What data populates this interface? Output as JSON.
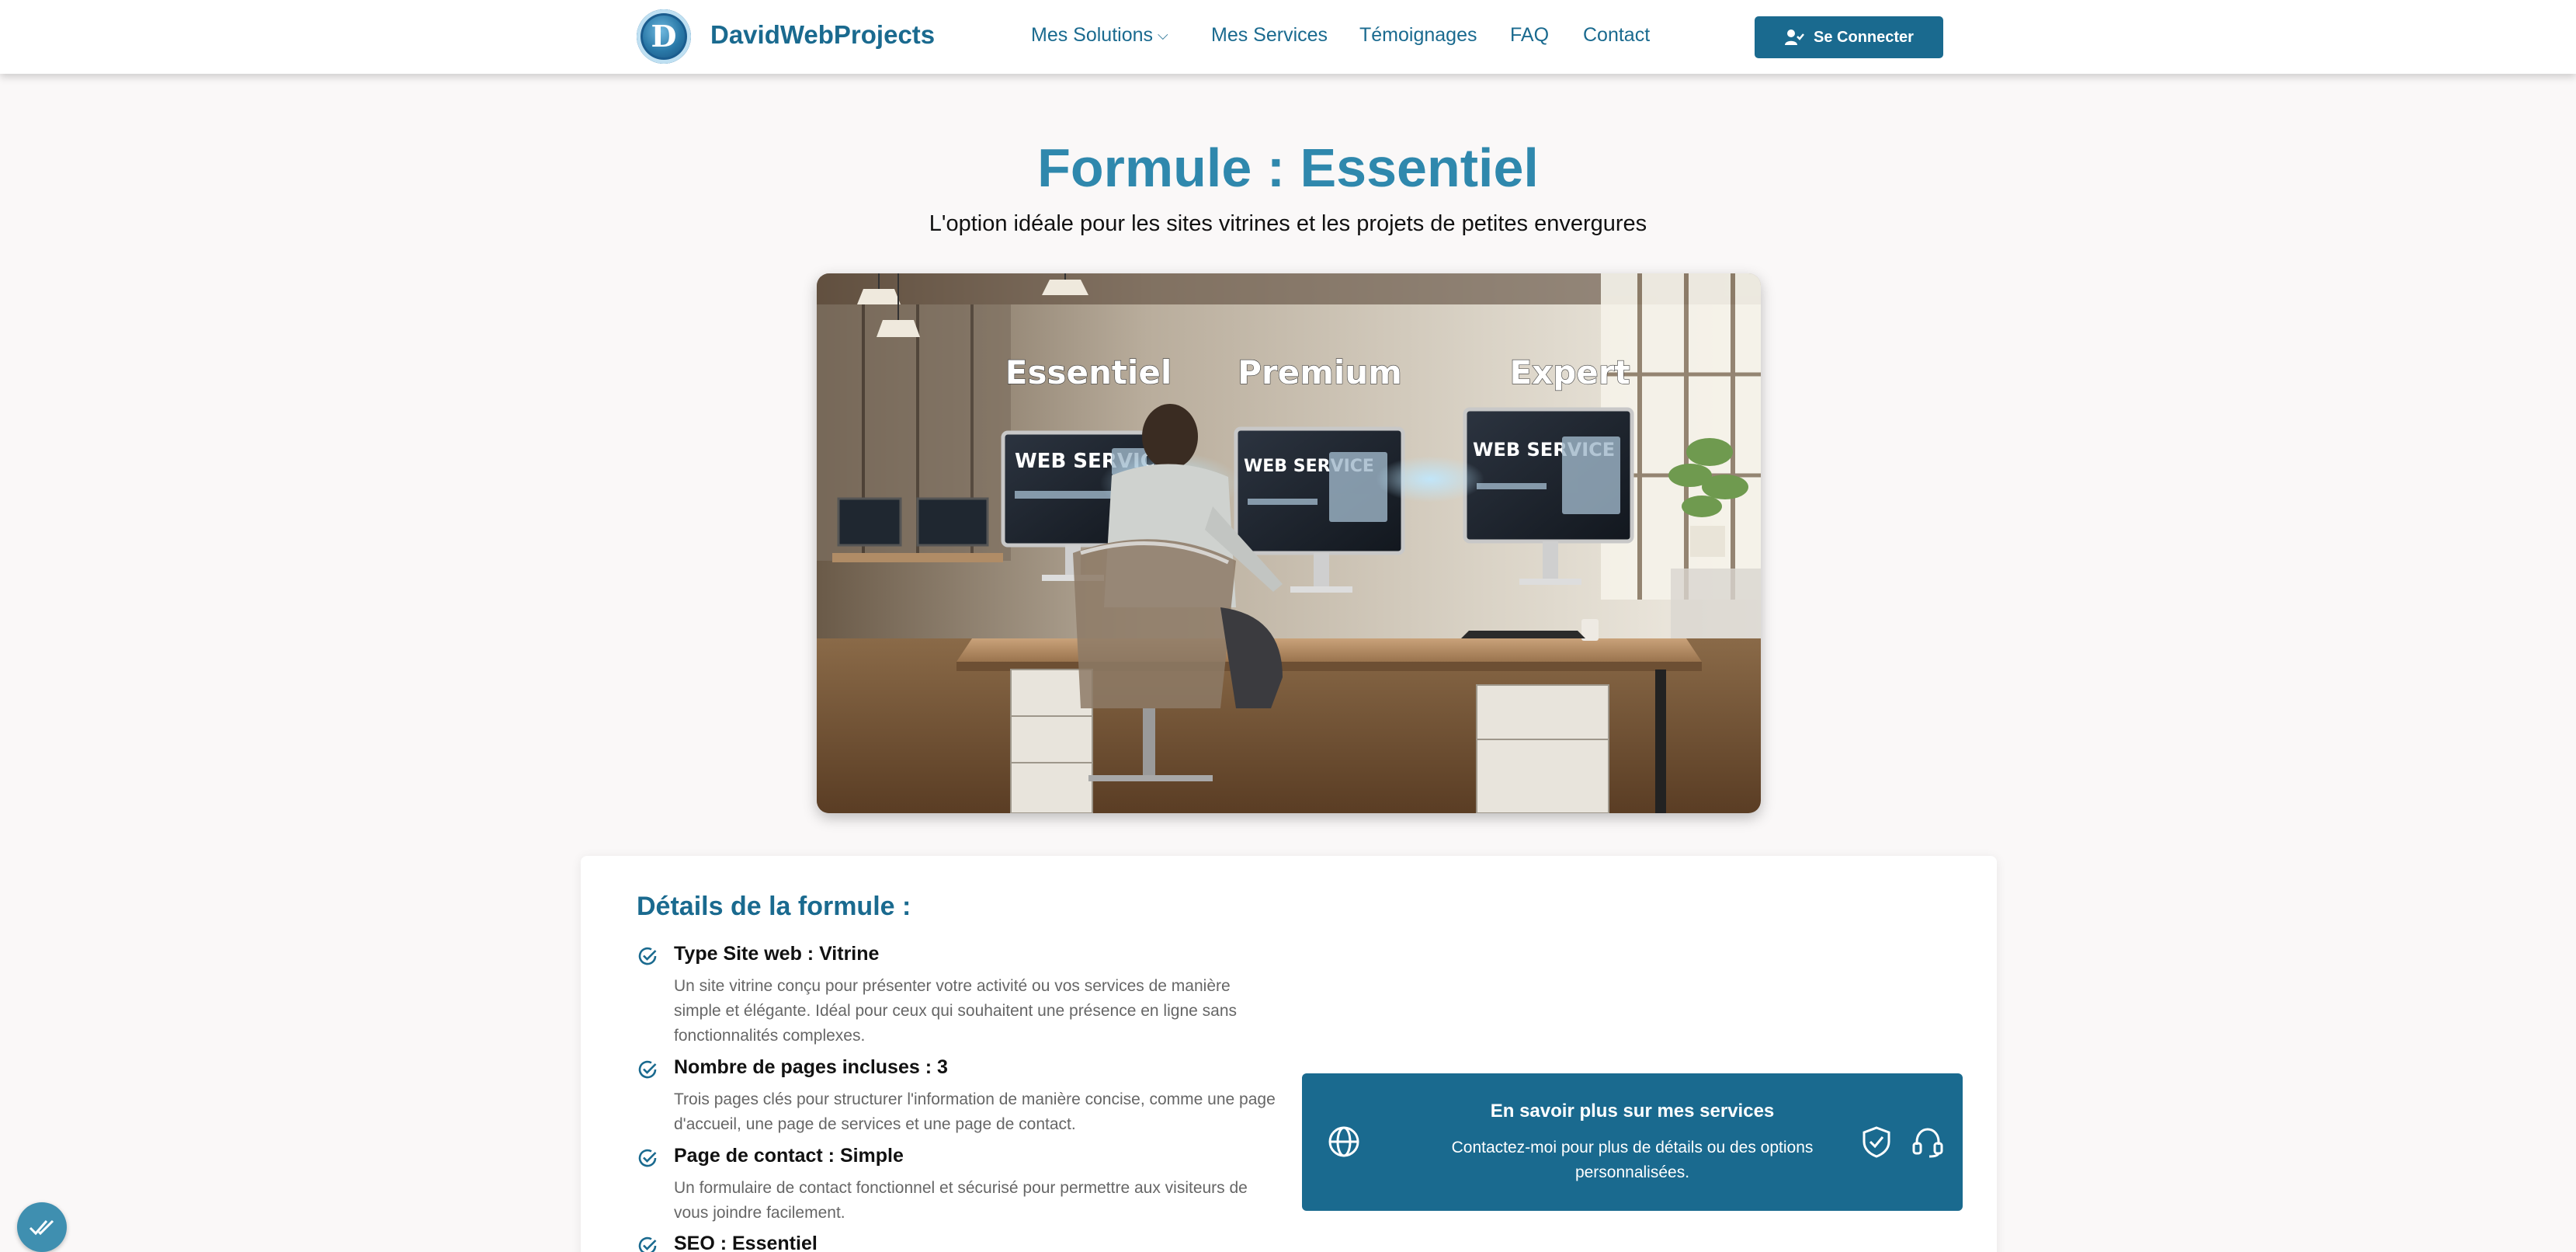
{
  "header": {
    "brand": "DavidWebProjects",
    "nav": [
      {
        "label": "Mes Solutions"
      },
      {
        "label": "Mes Services"
      },
      {
        "label": "Témoignages"
      },
      {
        "label": "FAQ"
      },
      {
        "label": "Contact"
      }
    ],
    "login_label": "Se Connecter"
  },
  "hero": {
    "title": "Formule : Essentiel",
    "subtitle": "L'option idéale pour les sites vitrines et les projets de petites envergures",
    "image_labels": [
      "Essentiel",
      "Premium",
      "Expert"
    ],
    "screen_text": [
      "WEB SERVICE",
      "WEB SERVICE",
      "WEB SERVICE"
    ]
  },
  "details": {
    "title": "Détails de la formule :",
    "features": [
      {
        "title": "Type Site web : Vitrine",
        "desc": "Un site vitrine conçu pour présenter votre activité ou vos services de manière simple et élégante. Idéal pour ceux qui souhaitent une présence en ligne sans fonctionnalités complexes."
      },
      {
        "title": "Nombre de pages incluses : 3",
        "desc": "Trois pages clés pour structurer l'information de manière concise, comme une page d'accueil, une page de services et une page de contact."
      },
      {
        "title": "Page de contact : Simple",
        "desc": "Un formulaire de contact fonctionnel et sécurisé pour permettre aux visiteurs de vous joindre facilement."
      },
      {
        "title": "SEO : Essentiel",
        "desc": ""
      }
    ]
  },
  "cta": {
    "title": "En savoir plus sur mes services",
    "text": "Contactez-moi pour plus de détails ou des options personnalisées."
  },
  "colors": {
    "brand": "#1a6a8f",
    "title": "#2f88ad",
    "page_bg": "#faf8f8"
  }
}
